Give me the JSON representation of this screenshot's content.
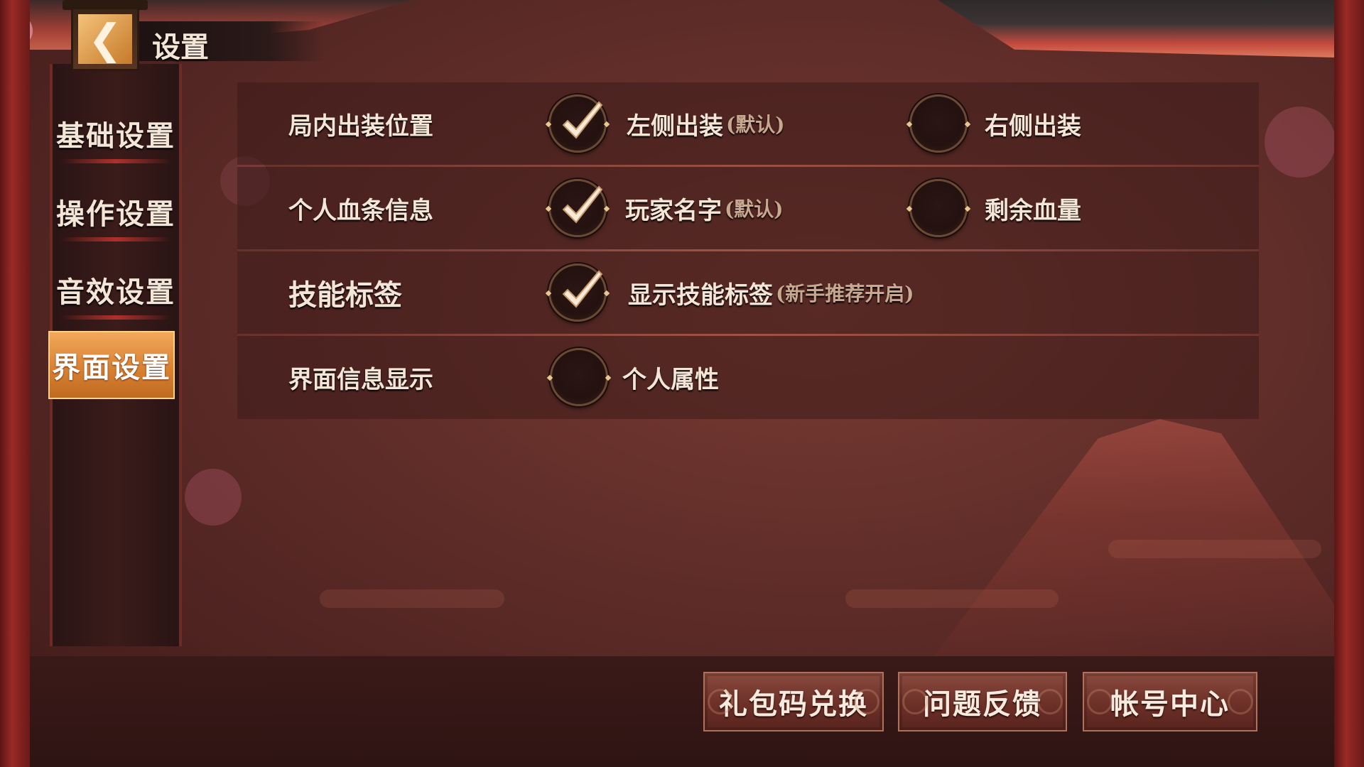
{
  "header": {
    "title": "设置",
    "back_glyph": "❮"
  },
  "sidebar": {
    "items": [
      {
        "label": "基础设置",
        "active": false
      },
      {
        "label": "操作设置",
        "active": false
      },
      {
        "label": "音效设置",
        "active": false
      },
      {
        "label": "界面设置",
        "active": true
      }
    ]
  },
  "settings": {
    "rows": [
      {
        "label": "局内出装位置",
        "options": [
          {
            "label": "左侧出装",
            "hint": "(默认)",
            "checked": true
          },
          {
            "label": "右侧出装",
            "hint": "",
            "checked": false
          }
        ]
      },
      {
        "label": "个人血条信息",
        "options": [
          {
            "label": "玩家名字",
            "hint": "(默认)",
            "checked": true
          },
          {
            "label": "剩余血量",
            "hint": "",
            "checked": false
          }
        ]
      },
      {
        "label": "技能标签",
        "options": [
          {
            "label": "显示技能标签",
            "hint": "(新手推荐开启)",
            "checked": true
          }
        ]
      },
      {
        "label": "界面信息显示",
        "options": [
          {
            "label": "个人属性",
            "hint": "",
            "checked": false
          }
        ]
      }
    ]
  },
  "footer": {
    "buttons": [
      {
        "label": "礼包码兑换"
      },
      {
        "label": "问题反馈"
      },
      {
        "label": "帐号中心"
      }
    ]
  },
  "colors": {
    "accent": "#d98232",
    "text": "#f3e6d6",
    "hint": "#c9a890",
    "background": "#5e2c28"
  }
}
